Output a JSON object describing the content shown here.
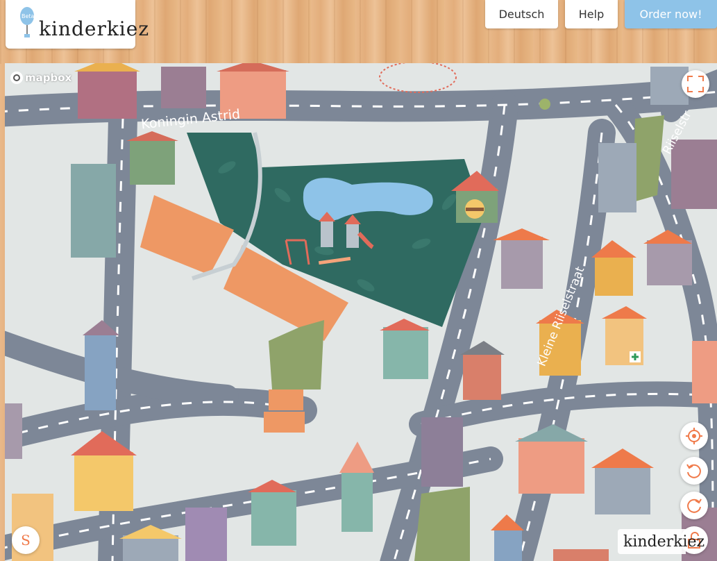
{
  "header": {
    "logo": {
      "name": "kinderkiez",
      "badge": "Beta"
    },
    "language_button": "Deutsch",
    "help_button": "Help",
    "order_button": "Order now!"
  },
  "map": {
    "attribution": "mapbox",
    "street_labels": [
      "Koningin Astrid",
      "Riiselstr",
      "Kleine Riiselstraat"
    ],
    "watermark": "kinderkiez",
    "shortcut_button": "S"
  },
  "controls": {
    "fullscreen": "fullscreen-icon",
    "locate": "locate-icon",
    "rotate_left": "rotate-left-icon",
    "rotate_right": "rotate-right-icon",
    "lock": "lock-icon"
  },
  "colors": {
    "accent": "#f07a4a",
    "order_button": "#8ec3e8",
    "road": "#7d8797",
    "park": "#2f6a61",
    "water": "#8ec3e8"
  }
}
